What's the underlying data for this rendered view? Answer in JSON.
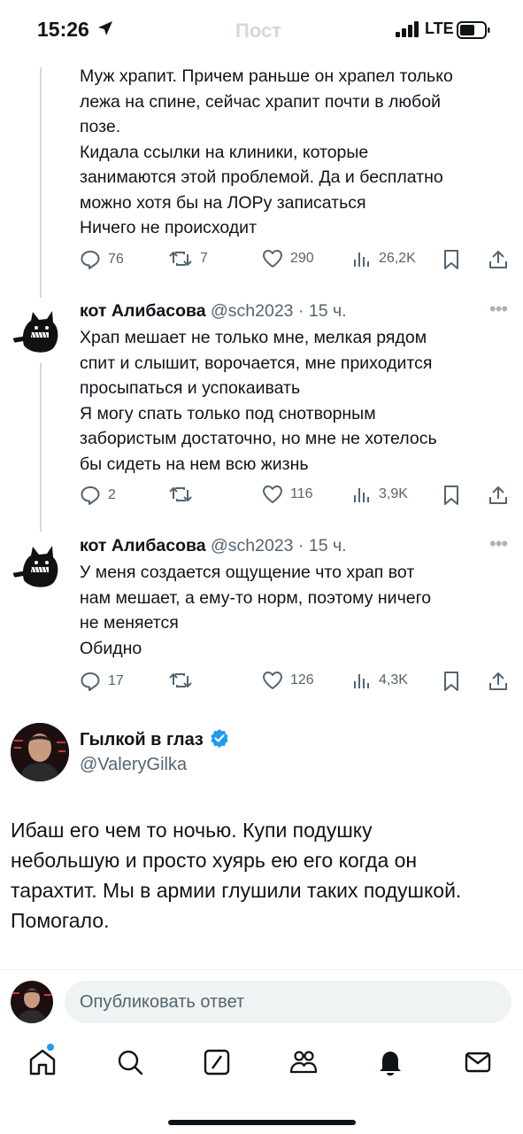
{
  "status_bar": {
    "time": "15:26",
    "network": "LTE",
    "header_title": "Пост"
  },
  "replies": [
    {
      "author": "",
      "handle": "",
      "time": "",
      "lines": [
        "Муж храпит. Причем раньше он храпел только",
        "лежа на спине, сейчас храпит почти в любой",
        "позе.",
        "Кидала ссылки на клиники, которые",
        "занимаются этой проблемой. Да и бесплатно",
        "можно хотя бы на ЛОРу записаться",
        "Ничего не происходит"
      ],
      "stats": {
        "replies": "76",
        "reposts": "7",
        "likes": "290",
        "views": "26,2K"
      }
    },
    {
      "author": "кот Алибасова",
      "handle": "@sch2023",
      "separator": "·",
      "time": "15 ч.",
      "lines": [
        "Храп мешает не только мне, мелкая рядом",
        "спит и слышит, ворочается, мне приходится",
        "просыпаться и успокаивать",
        "Я могу спать только под снотворным",
        "забористым достаточно, но мне не хотелось",
        "бы сидеть на нем всю жизнь"
      ],
      "stats": {
        "replies": "2",
        "reposts": "",
        "likes": "116",
        "views": "3,9K"
      }
    },
    {
      "author": "кот Алибасова",
      "handle": "@sch2023",
      "separator": "·",
      "time": "15 ч.",
      "lines": [
        "У меня создается ощущение что храп вот",
        "нам мешает, а ему-то норм, поэтому ничего",
        "не меняется",
        "Обидно"
      ],
      "stats": {
        "replies": "17",
        "reposts": "",
        "likes": "126",
        "views": "4,3K"
      }
    }
  ],
  "main_post": {
    "author": "Гылкой в глаз",
    "verified": true,
    "handle": "@ValeryGilka",
    "lines": [
      "Ибаш его чем то ночью. Купи подушку",
      "небольшую и просто хуярь ею его когда он",
      "тарахтит. Мы в армии глушили таких подушкой.",
      "Помогало."
    ]
  },
  "reply_box": {
    "placeholder": "Опубликовать ответ"
  },
  "tab_bar": {
    "items": [
      "home-icon",
      "search-icon",
      "grok-icon",
      "communities-icon",
      "notifications-icon",
      "messages-icon"
    ],
    "home_has_dot": true
  },
  "colors": {
    "text": "#0f1419",
    "secondary": "#536471",
    "accent": "#1d9bf0",
    "thread_line": "#cfd9de"
  }
}
